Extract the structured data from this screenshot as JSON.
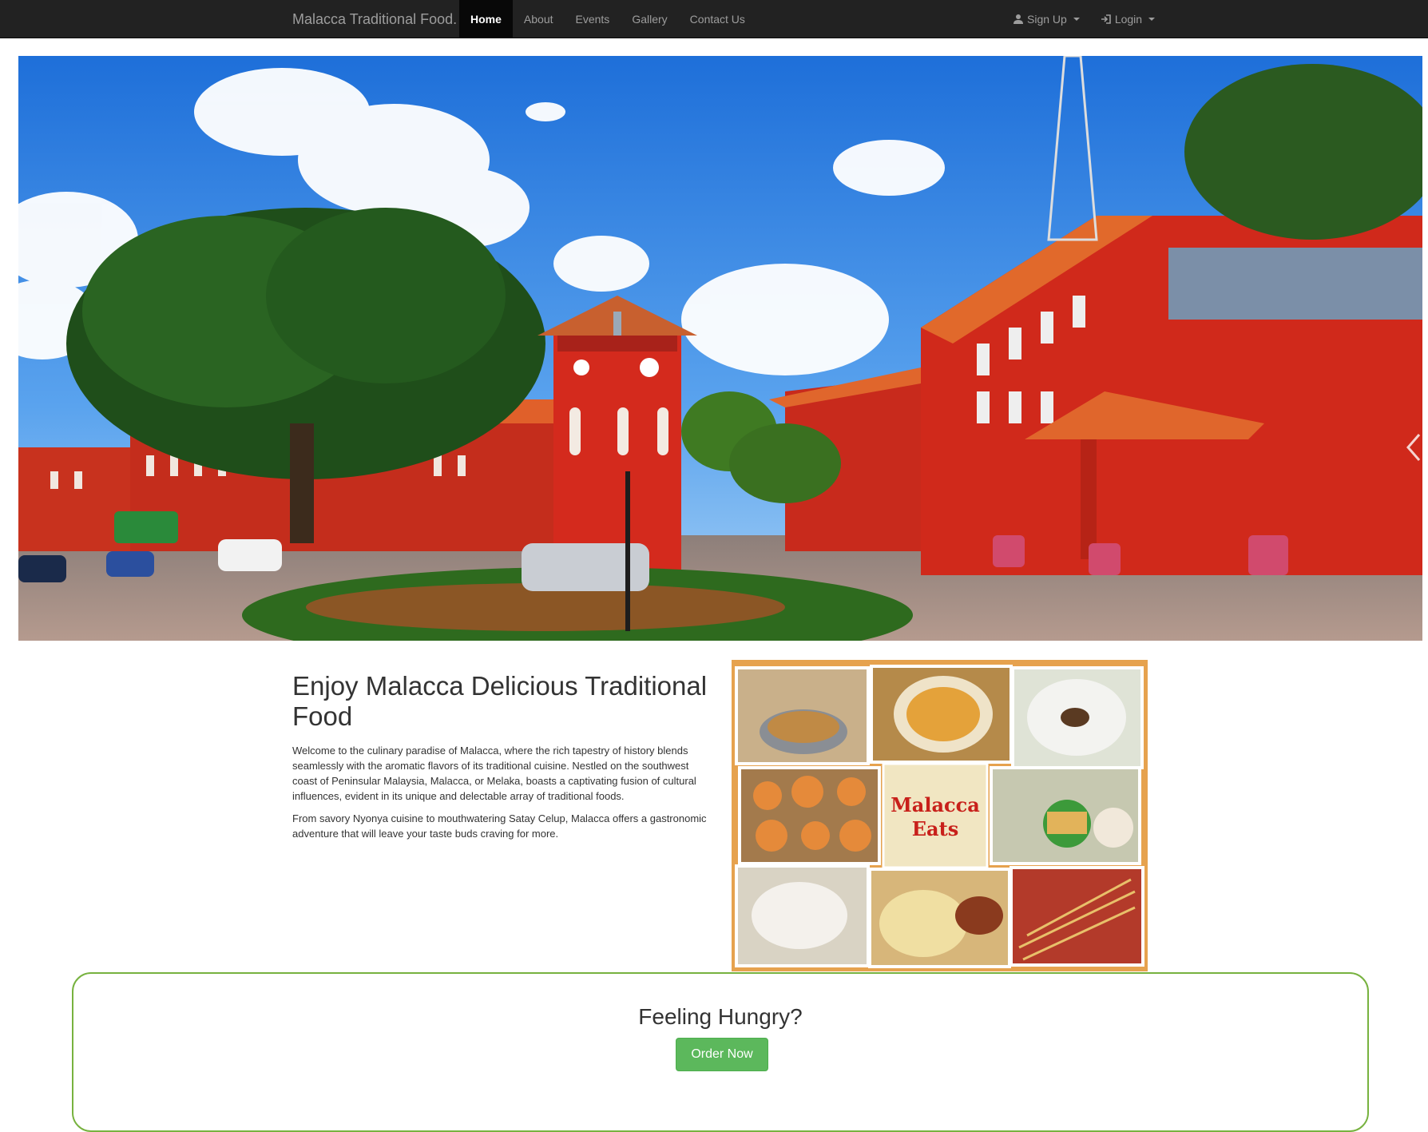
{
  "navbar": {
    "brand": "Malacca Traditional Food.",
    "links": [
      {
        "label": "Home",
        "active": true
      },
      {
        "label": "About"
      },
      {
        "label": "Events"
      },
      {
        "label": "Gallery"
      },
      {
        "label": "Contact Us"
      }
    ],
    "right": [
      {
        "label": "Sign Up",
        "icon": "user-icon"
      },
      {
        "label": "Login",
        "icon": "login-icon"
      }
    ]
  },
  "hero": {
    "image": "malacca-red-square-photo",
    "next_icon": "chevron-right-icon"
  },
  "intro": {
    "headline": "Enjoy Malacca Delicious Traditional Food",
    "paragraph1": "Welcome to the culinary paradise of Malacca, where the rich tapestry of history blends seamlessly with the aromatic flavors of its traditional cuisine. Nestled on the southwest coast of Peninsular Malaysia, Malacca, or Melaka, boasts a captivating fusion of cultural influences, evident in its unique and delectable array of traditional foods.",
    "paragraph2": "From savory Nyonya cuisine to mouthwatering Satay Celup, Malacca offers a gastronomic adventure that will leave your taste buds craving for more."
  },
  "collage": {
    "center_line1": "Malacca",
    "center_line2": "Eats"
  },
  "cta": {
    "title": "Feeling Hungry?",
    "button": "Order Now"
  },
  "colors": {
    "navbar_bg": "#222222",
    "accent_green": "#5cb85c",
    "cta_border": "#77b23f",
    "building_red": "#d42a1d"
  }
}
